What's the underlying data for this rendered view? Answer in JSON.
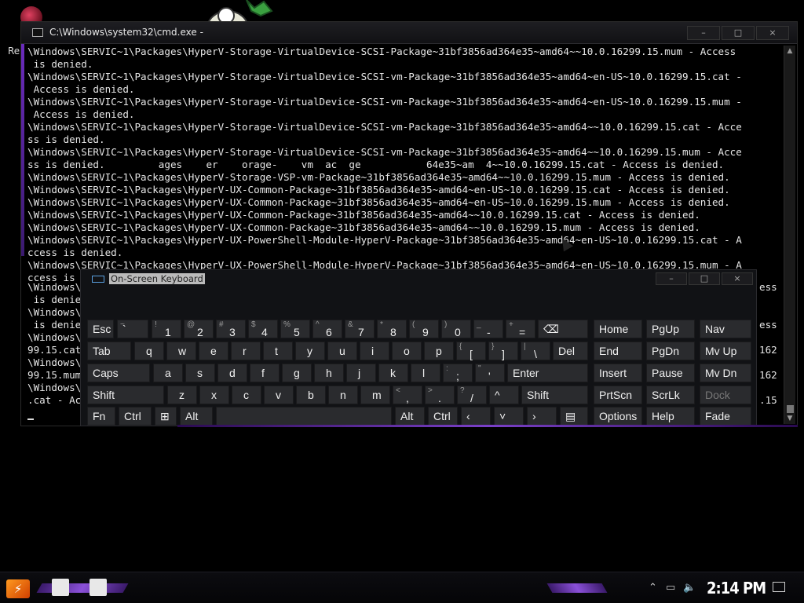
{
  "desktop": {
    "recycle_label": "Re"
  },
  "cmd": {
    "title": "C:\\Windows\\system32\\cmd.exe - ",
    "minimize": "–",
    "maximize": "□",
    "close": "×",
    "lines": [
      "\\Windows\\SERVIC~1\\Packages\\HyperV-Storage-VirtualDevice-SCSI-Package~31bf3856ad364e35~amd64~~10.0.16299.15.mum - Access",
      " is denied.",
      "\\Windows\\SERVIC~1\\Packages\\HyperV-Storage-VirtualDevice-SCSI-vm-Package~31bf3856ad364e35~amd64~en-US~10.0.16299.15.cat -",
      " Access is denied.",
      "\\Windows\\SERVIC~1\\Packages\\HyperV-Storage-VirtualDevice-SCSI-vm-Package~31bf3856ad364e35~amd64~en-US~10.0.16299.15.mum -",
      " Access is denied.",
      "\\Windows\\SERVIC~1\\Packages\\HyperV-Storage-VirtualDevice-SCSI-vm-Package~31bf3856ad364e35~amd64~~10.0.16299.15.cat - Acce",
      "ss is denied.",
      "\\Windows\\SERVIC~1\\Packages\\HyperV-Storage-VirtualDevice-SCSI-vm-Package~31bf3856ad364e35~amd64~~10.0.16299.15.mum - Acce",
      "ss is denied.         ages    er    orage-    vm  ac  ge           64e35~am  4~~10.0.16299.15.cat - Access is denied.",
      "\\Windows\\SERVIC~1\\Packages\\HyperV-Storage-VSP-vm-Package~31bf3856ad364e35~amd64~~10.0.16299.15.mum - Access is denied.",
      "\\Windows\\SERVIC~1\\Packages\\HyperV-UX-Common-Package~31bf3856ad364e35~amd64~en-US~10.0.16299.15.cat - Access is denied.",
      "\\Windows\\SERVIC~1\\Packages\\HyperV-UX-Common-Package~31bf3856ad364e35~amd64~en-US~10.0.16299.15.mum - Access is denied.",
      "\\Windows\\SERVIC~1\\Packages\\HyperV-UX-Common-Package~31bf3856ad364e35~amd64~~10.0.16299.15.cat - Access is denied.",
      "\\Windows\\SERVIC~1\\Packages\\HyperV-UX-Common-Package~31bf3856ad364e35~amd64~~10.0.16299.15.mum - Access is denied.",
      "\\Windows\\SERVIC~1\\Packages\\HyperV-UX-PowerShell-Module-HyperV-Package~31bf3856ad364e35~amd64~en-US~10.0.16299.15.cat - A",
      "ccess is denied.",
      "\\Windows\\SERVIC~1\\Packages\\HyperV-UX-PowerShell-Module-HyperV-Package~31bf3856ad364e35~amd64~en-US~10.0.16299.15.mum - A",
      "ccess is "
    ],
    "left_fragments": "\\Windows\\\n is denie\n\\Windows\\\n is denie\n\\Windows\\\n99.15.cat\n\\Windows\\\n99.15.mum\n\\Windows\\\n.cat - Ac",
    "right_fragments": "ess\n\n\ness\n\n162\n\n162\n\n.15"
  },
  "osk": {
    "title": "On-Screen Keyboard",
    "minimize": "–",
    "maximize": "□",
    "close": "×",
    "keys": {
      "esc": "Esc",
      "tilde_sup": "~",
      "backtick": "`",
      "k1_sup": "!",
      "k1": "1",
      "k2_sup": "@",
      "k2": "2",
      "k3_sup": "#",
      "k3": "3",
      "k4_sup": "$",
      "k4": "4",
      "k5_sup": "%",
      "k5": "5",
      "k6_sup": "^",
      "k6": "6",
      "k7_sup": "&",
      "k7": "7",
      "k8_sup": "*",
      "k8": "8",
      "k9_sup": "(",
      "k9": "9",
      "k0_sup": ")",
      "k0": "0",
      "minus_sup": "_",
      "minus": "-",
      "plus_sup": "+",
      "equals": "=",
      "backspace": "⌫",
      "tab": "Tab",
      "q": "q",
      "w": "w",
      "e": "e",
      "r": "r",
      "t": "t",
      "y": "y",
      "u": "u",
      "i": "i",
      "o": "o",
      "p": "p",
      "lbrace_sup": "{",
      "lbracket": "[",
      "rbrace_sup": "}",
      "rbracket": "]",
      "pipe_sup": "|",
      "backslash": "\\",
      "del": "Del",
      "caps": "Caps",
      "a": "a",
      "s": "s",
      "d": "d",
      "f": "f",
      "g": "g",
      "h": "h",
      "j": "j",
      "k": "k",
      "l": "l",
      "colon_sup": ":",
      "semicolon": ";",
      "quote_sup": "\"",
      "apostrophe": "'",
      "enter": "Enter",
      "lshift": "Shift",
      "z": "z",
      "x": "x",
      "c": "c",
      "v": "v",
      "b": "b",
      "n": "n",
      "m": "m",
      "lt_sup": "<",
      "comma": ",",
      "gt_sup": ">",
      "period": ".",
      "question_sup": "?",
      "slash": "/",
      "up": "^",
      "rshift": "Shift",
      "fn": "Fn",
      "lctrl": "Ctrl",
      "win": "⊞",
      "lalt": "Alt",
      "ralt": "Alt",
      "rctrl": "Ctrl",
      "left": "‹",
      "down": "˅",
      "right": "›",
      "menu": "▤",
      "home": "Home",
      "pgup": "PgUp",
      "nav": "Nav",
      "end": "End",
      "pgdn": "PgDn",
      "mvup": "Mv Up",
      "insert": "Insert",
      "pause": "Pause",
      "mvdn": "Mv Dn",
      "prtscn": "PrtScn",
      "scrlk": "ScrLk",
      "dock": "Dock",
      "options": "Options",
      "help": "Help",
      "fade": "Fade"
    }
  },
  "taskbar": {
    "clock": "2:14 PM",
    "start_glyph": "⚡"
  }
}
